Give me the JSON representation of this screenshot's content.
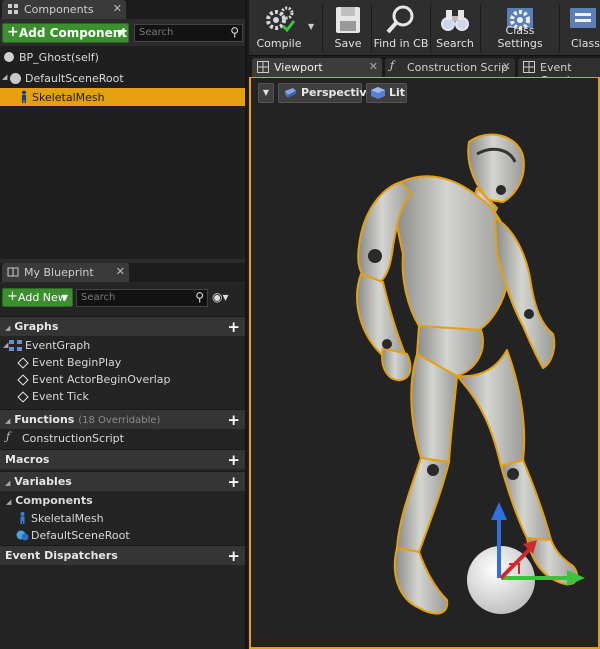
{
  "components_panel": {
    "tab_label": "Components",
    "add_component_label": "Add Component",
    "search_placeholder": "Search",
    "tree": [
      {
        "label": "BP_Ghost(self)"
      },
      {
        "label": "DefaultSceneRoot"
      },
      {
        "label": "SkeletalMesh",
        "selected": true
      }
    ]
  },
  "my_blueprint": {
    "tab_label": "My Blueprint",
    "add_new_label": "Add New",
    "search_placeholder": "Search",
    "sections": {
      "graphs": "Graphs",
      "functions": "Functions",
      "functions_sub": "(18 Overridable)",
      "macros": "Macros",
      "variables": "Variables",
      "event_dispatchers": "Event Dispatchers"
    },
    "graph_items": [
      "EventGraph",
      "Event BeginPlay",
      "Event ActorBeginOverlap",
      "Event Tick"
    ],
    "function_items": [
      "ConstructionScript"
    ],
    "variables_subheading": "Components",
    "variable_items": [
      "SkeletalMesh",
      "DefaultSceneRoot"
    ]
  },
  "toolbar": {
    "compile": "Compile",
    "save": "Save",
    "find_in_cb": "Find in CB",
    "search": "Search",
    "class_settings": "Class Settings",
    "class_defaults": "Class"
  },
  "editor_tabs": [
    "Viewport",
    "Construction Scrip",
    "Event Graph"
  ],
  "viewport": {
    "perspective_label": "Perspective",
    "lit_label": "Lit"
  },
  "colors": {
    "accent_orange": "#e5a00d",
    "add_green": "#3b8f2e",
    "gizmo_x": "#3cc23c",
    "gizmo_z": "#2f6fe0",
    "gizmo_y": "#d02b2b"
  }
}
